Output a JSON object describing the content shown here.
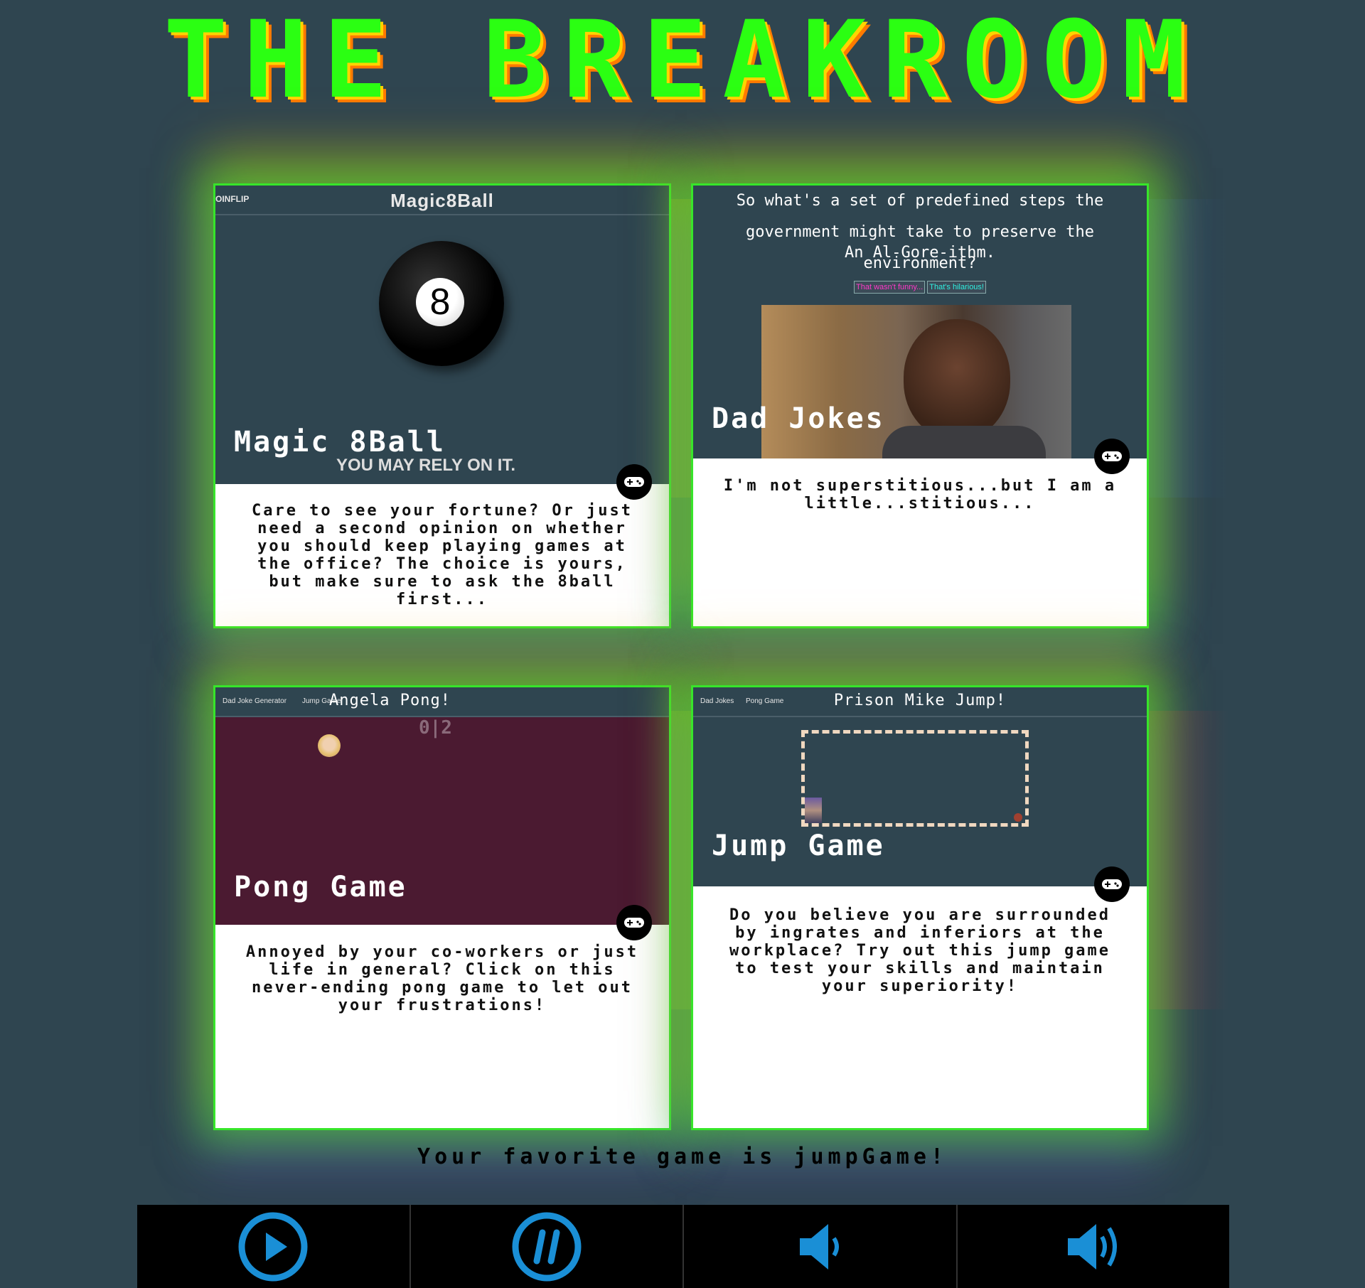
{
  "site_title": "THE BREAKROOM",
  "cards": {
    "magic8": {
      "nav_link": "OINFLIP",
      "nav_title": "Magic8Ball",
      "ball_number": "8",
      "label": "Magic 8Ball",
      "sublabel": "YOU MAY RELY ON IT.",
      "description": "Care to see your fortune? Or just need a second opinion on whether you should keep playing games at the office? The choice is yours, but make sure to ask the 8ball first..."
    },
    "dadjokes": {
      "joke_question": "So what's a set of predefined steps the government might take to preserve the environment?",
      "joke_answer": "An Al-Gore-ithm.",
      "button_not_funny": "That wasn't funny...",
      "button_funny": "That's hilarious!",
      "label": "Dad Jokes",
      "description": "I'm not superstitious...but I am a little...stitious..."
    },
    "pong": {
      "nav_links": [
        "Dad Joke Generator",
        "Jump Game"
      ],
      "nav_title": "Angela Pong!",
      "score": "0|2",
      "label": "Pong Game",
      "description": "Annoyed by your co-workers or just life in general? Click on this never-ending pong game to let out your frustrations!"
    },
    "jump": {
      "nav_links": [
        "Dad Jokes",
        "Pong Game"
      ],
      "nav_title": "Prison Mike Jump!",
      "label": "Jump Game",
      "description": "Do you believe you are surrounded by ingrates and inferiors at the workplace? Try out this jump game to test your skills and maintain your superiority!"
    }
  },
  "favorite_text": "Your favorite game is jumpGame!",
  "controls": [
    "play-icon",
    "pause-icon",
    "volume-low-icon",
    "volume-high-icon"
  ],
  "colors": {
    "background": "#2f4550",
    "title_green": "#2bff12",
    "pong_bg": "#4b1a31",
    "control_blue": "#1a8fd6"
  }
}
